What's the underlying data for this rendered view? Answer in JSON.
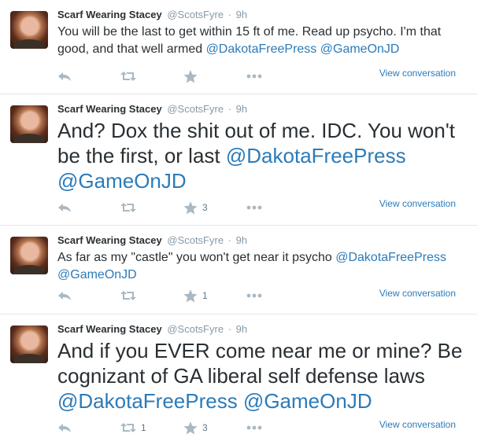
{
  "tweets": [
    {
      "fullname": "Scarf Wearing Stacey",
      "username": "@ScotsFyre",
      "separator": "·",
      "time": "9h",
      "text_before": "You will be the last to get within 15 ft of me. Read up psycho. I'm that good, and that well armed ",
      "mention1": "@DakotaFreePress",
      "mention_gap": " ",
      "mention2": "@GameOnJD",
      "retweets": "",
      "favorites": "",
      "view_conversation": "View conversation"
    },
    {
      "fullname": "Scarf Wearing Stacey",
      "username": "@ScotsFyre",
      "separator": "·",
      "time": "9h",
      "text_before": "And? Dox the shit out of me. IDC. You won't be the first, or last ",
      "mention1": "@DakotaFreePress",
      "mention_gap": " ",
      "mention2": "@GameOnJD",
      "retweets": "",
      "favorites": "3",
      "view_conversation": "View conversation"
    },
    {
      "fullname": "Scarf Wearing Stacey",
      "username": "@ScotsFyre",
      "separator": "·",
      "time": "9h",
      "text_before": "As far as my \"castle\" you won't get near it psycho ",
      "mention1": "@DakotaFreePress",
      "mention_gap": " ",
      "mention2": "@GameOnJD",
      "retweets": "",
      "favorites": "1",
      "view_conversation": "View conversation"
    },
    {
      "fullname": "Scarf Wearing Stacey",
      "username": "@ScotsFyre",
      "separator": "·",
      "time": "9h",
      "text_before": "And if you EVER come near me or mine? Be cognizant of GA liberal self defense laws ",
      "mention1": "@DakotaFreePress",
      "mention_gap": " ",
      "mention2": "@GameOnJD",
      "retweets": "1",
      "favorites": "3",
      "view_conversation": "View conversation"
    }
  ],
  "colors": {
    "link": "#2b7bb9",
    "muted": "#8899a6",
    "icon": "#aab8c2",
    "text": "#292f33",
    "divider": "#e1e8ed"
  },
  "icons": [
    "reply-icon",
    "retweet-icon",
    "favorite-icon",
    "more-icon"
  ]
}
